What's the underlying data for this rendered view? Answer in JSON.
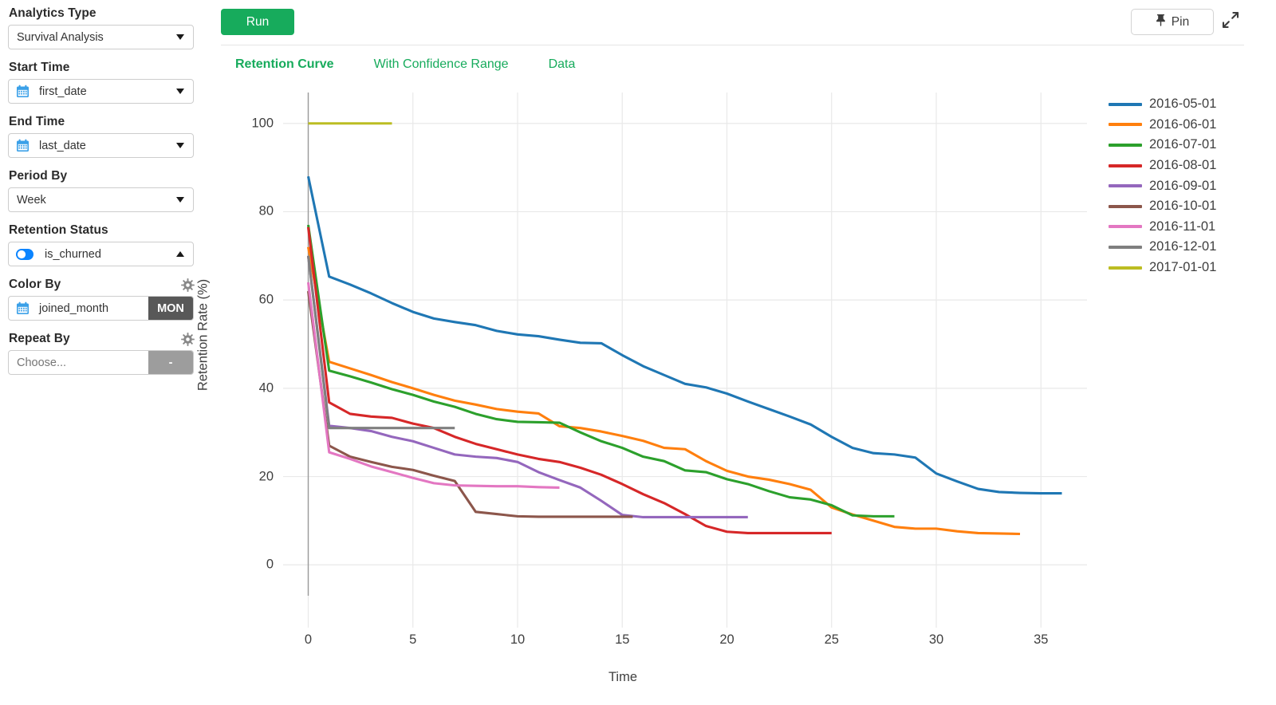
{
  "sidebar": {
    "fields": [
      {
        "label": "Analytics Type",
        "value": "Survival Analysis",
        "icon": null,
        "caret": "down",
        "suffix": null,
        "placeholder": null
      },
      {
        "label": "Start Time",
        "value": "first_date",
        "icon": "calendar-icon",
        "caret": "down",
        "suffix": null,
        "placeholder": null
      },
      {
        "label": "End Time",
        "value": "last_date",
        "icon": "calendar-icon",
        "caret": "down",
        "suffix": null,
        "placeholder": null
      },
      {
        "label": "Period By",
        "value": "Week",
        "icon": null,
        "caret": "down",
        "suffix": null,
        "placeholder": null
      },
      {
        "label": "Retention Status",
        "value": "is_churned",
        "icon": "toggle-icon",
        "caret": "up",
        "suffix": null,
        "placeholder": null
      },
      {
        "label": "Color By",
        "value": "joined_month",
        "icon": "calendar-icon",
        "caret": null,
        "suffix": "MON",
        "suffix_style": "dark",
        "gear": true,
        "placeholder": null
      },
      {
        "label": "Repeat By",
        "value": "",
        "icon": null,
        "caret": null,
        "suffix": "-",
        "suffix_style": "grey",
        "gear": true,
        "placeholder": "Choose..."
      }
    ]
  },
  "toolbar": {
    "run_label": "Run",
    "pin_label": "Pin",
    "pin_icon": "pushpin-icon",
    "expand_icon": "expand-diagonal-icon"
  },
  "tabs": [
    {
      "label": "Retention Curve",
      "active": true
    },
    {
      "label": "With Confidence Range",
      "active": false
    },
    {
      "label": "Data",
      "active": false
    }
  ],
  "chart_data": {
    "type": "line",
    "title": "",
    "xlabel": "Time",
    "ylabel": "Retention Rate (%)",
    "xlim": [
      -1.2,
      37.2
    ],
    "ylim": [
      -7,
      107
    ],
    "xticks": [
      0,
      5,
      10,
      15,
      20,
      25,
      30,
      35
    ],
    "yticks": [
      0,
      20,
      40,
      60,
      80,
      100
    ],
    "grid": true,
    "legend_position": "right",
    "series": [
      {
        "name": "2016-05-01",
        "color": "#1f77b4",
        "x": [
          0,
          1,
          2,
          3,
          4,
          5,
          6,
          7,
          8,
          9,
          10,
          11,
          12,
          13,
          14,
          15,
          16,
          17,
          18,
          19,
          20,
          21,
          22,
          23,
          24,
          25,
          26,
          27,
          28,
          29,
          30,
          31,
          32,
          33,
          34,
          35,
          36
        ],
        "y": [
          88.0,
          65.3,
          63.5,
          61.5,
          59.3,
          57.3,
          55.8,
          55.0,
          54.3,
          53.0,
          52.2,
          51.8,
          51.0,
          50.3,
          50.2,
          47.5,
          45.0,
          43.0,
          41.0,
          40.2,
          38.8,
          37.0,
          35.3,
          33.6,
          31.8,
          29.0,
          26.5,
          25.3,
          25.0,
          24.3,
          20.7,
          18.9,
          17.2,
          16.5,
          16.3,
          16.2,
          16.2
        ]
      },
      {
        "name": "2016-06-01",
        "color": "#ff7f0e",
        "x": [
          0,
          1,
          2,
          3,
          4,
          5,
          6,
          7,
          8,
          9,
          10,
          11,
          12,
          13,
          14,
          15,
          16,
          17,
          18,
          19,
          20,
          21,
          22,
          23,
          24,
          25,
          26,
          27,
          28,
          29,
          30,
          31,
          32,
          33,
          34
        ],
        "y": [
          72.0,
          46.0,
          44.5,
          43.0,
          41.4,
          40.0,
          38.5,
          37.2,
          36.3,
          35.3,
          34.7,
          34.3,
          31.4,
          31.0,
          30.2,
          29.2,
          28.1,
          26.5,
          26.2,
          23.5,
          21.3,
          20.0,
          19.3,
          18.3,
          17.0,
          13.0,
          11.4,
          10.0,
          8.6,
          8.2,
          8.2,
          7.6,
          7.2,
          7.1,
          7.0
        ]
      },
      {
        "name": "2016-07-01",
        "color": "#2ca02c",
        "x": [
          0,
          1,
          2,
          3,
          4,
          5,
          6,
          7,
          8,
          9,
          10,
          11,
          12,
          13,
          14,
          15,
          16,
          17,
          18,
          19,
          20,
          21,
          22,
          23,
          24,
          25,
          26,
          27,
          28
        ],
        "y": [
          77.0,
          44.0,
          42.7,
          41.3,
          39.8,
          38.5,
          37.0,
          35.8,
          34.2,
          33.0,
          32.4,
          32.3,
          32.2,
          30.0,
          28.0,
          26.5,
          24.5,
          23.5,
          21.4,
          21.0,
          19.4,
          18.3,
          16.7,
          15.3,
          14.8,
          13.5,
          11.2,
          11.0,
          11.0
        ]
      },
      {
        "name": "2016-08-01",
        "color": "#d62728",
        "x": [
          0,
          1,
          2,
          3,
          4,
          5,
          6,
          7,
          8,
          9,
          10,
          11,
          12,
          13,
          14,
          15,
          16,
          17,
          18,
          19,
          20,
          21,
          22,
          23,
          24,
          25
        ],
        "y": [
          76.5,
          36.8,
          34.2,
          33.6,
          33.3,
          32.0,
          31.0,
          29.0,
          27.4,
          26.2,
          25.0,
          24.0,
          23.3,
          22.0,
          20.4,
          18.3,
          16.0,
          14.0,
          11.5,
          8.8,
          7.5,
          7.2,
          7.2,
          7.2,
          7.2,
          7.2
        ]
      },
      {
        "name": "2016-09-01",
        "color": "#9467bd",
        "x": [
          0,
          1,
          2,
          3,
          4,
          5,
          6,
          7,
          8,
          9,
          10,
          11,
          12,
          13,
          14,
          15,
          16,
          17,
          18,
          19,
          20,
          21
        ],
        "y": [
          70.0,
          31.5,
          31.0,
          30.3,
          29.0,
          28.0,
          26.5,
          25.0,
          24.5,
          24.2,
          23.3,
          21.0,
          19.2,
          17.5,
          14.5,
          11.3,
          10.8,
          10.8,
          10.8,
          10.8,
          10.8,
          10.8
        ]
      },
      {
        "name": "2016-10-01",
        "color": "#8c564b",
        "x": [
          0,
          1,
          2,
          3,
          4,
          5,
          6,
          7,
          8,
          9,
          10,
          11,
          12,
          13,
          14,
          15,
          15.5
        ],
        "y": [
          62.0,
          27.0,
          24.5,
          23.3,
          22.2,
          21.5,
          20.2,
          19.0,
          12.0,
          11.5,
          11.0,
          10.9,
          10.9,
          10.9,
          10.9,
          10.9,
          10.9
        ]
      },
      {
        "name": "2016-11-01",
        "color": "#e377c2",
        "x": [
          0,
          1,
          2,
          3,
          4,
          5,
          6,
          7,
          8,
          9,
          10,
          11,
          12
        ],
        "y": [
          64.0,
          25.5,
          24.0,
          22.3,
          21.0,
          19.7,
          18.5,
          18.0,
          17.9,
          17.8,
          17.8,
          17.6,
          17.5
        ]
      },
      {
        "name": "2016-12-01",
        "color": "#7f7f7f",
        "x": [
          0,
          1,
          2,
          3,
          4,
          5,
          6,
          7
        ],
        "y": [
          70.0,
          31.0,
          31.0,
          31.0,
          31.0,
          31.0,
          31.0,
          31.0
        ]
      },
      {
        "name": "2017-01-01",
        "color": "#bcbd22",
        "x": [
          0,
          1,
          2,
          3,
          4
        ],
        "y": [
          100.0,
          100.0,
          100.0,
          100.0,
          100.0
        ]
      }
    ]
  }
}
